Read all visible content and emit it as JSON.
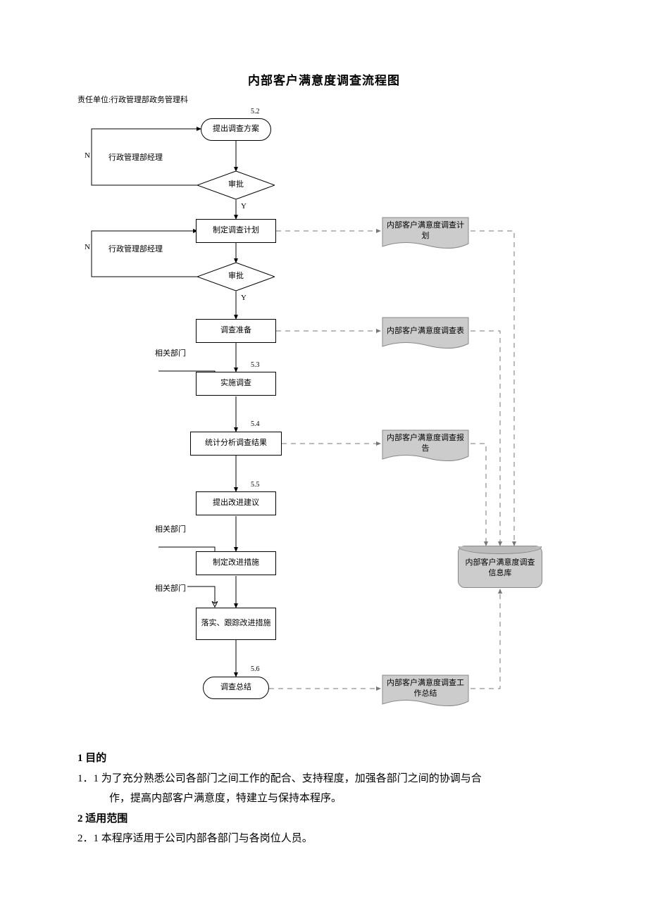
{
  "title": "内部客户满意度调查流程图",
  "owner": "责任单位:行政管理部政务管理科",
  "nodes": {
    "start_num": "5.2",
    "start": "提出调查方案",
    "approve1_side": "行政管理部经理",
    "approve1": "审批",
    "plan": "制定调查计划",
    "approve2_side": "行政管理部经理",
    "approve2": "审批",
    "prep": "调查准备",
    "dept1": "相关部门",
    "impl_num": "5.3",
    "impl": "实施调查",
    "stat_num": "5.4",
    "stat": "统计分析调查结果",
    "sugg_num": "5.5",
    "sugg": "提出改进建议",
    "dept2": "相关部门",
    "measure": "制定改进措施",
    "dept3": "相关部门",
    "track": "落实、跟踪改进措施",
    "sum_num": "5.6",
    "sum": "调查总结",
    "doc_plan": "内部客户满意度调查计划",
    "doc_table": "内部客户满意度调查表",
    "doc_report": "内部客户满意度调查报告",
    "doc_summary": "内部客户满意度调查工作总结",
    "db": "内部客户满意度调查信息库",
    "Y": "Y",
    "N": "N"
  },
  "text": {
    "s1_h": "1 目的",
    "s1_1a": "1．1 为了充分熟悉公司各部门之间工作的配合、支持程度，加强各部门之间的协调与合",
    "s1_1b": "作，提高内部客户满意度，特建立与保持本程序。",
    "s2_h": "2 适用范围",
    "s2_1": "2．1 本程序适用于公司内部各部门与各岗位人员。"
  }
}
